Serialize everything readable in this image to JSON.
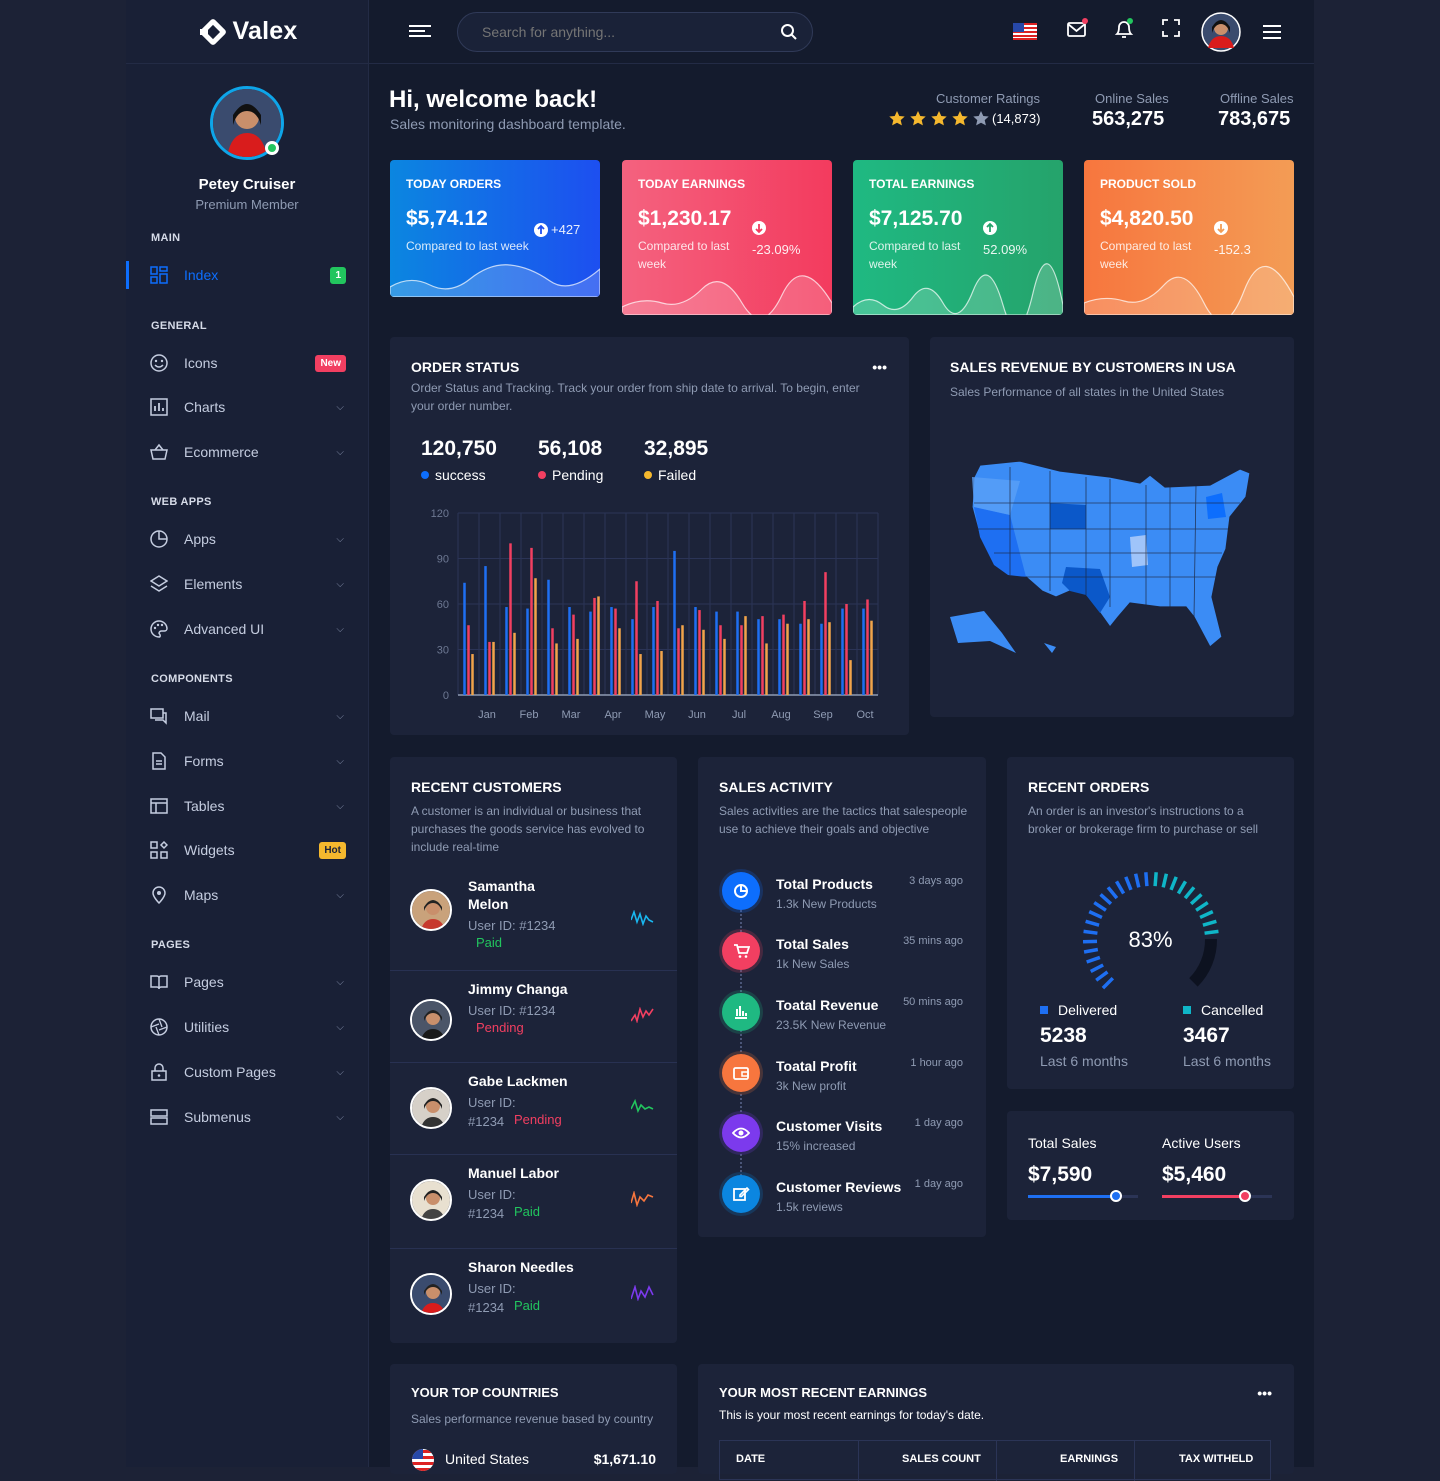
{
  "brand": {
    "name": "Valex"
  },
  "profile": {
    "name": "Petey Cruiser",
    "role": "Premium Member"
  },
  "sidebar": {
    "sections": {
      "main": "MAIN",
      "general": "GENERAL",
      "webapps": "WEB APPS",
      "components": "COMPONENTS",
      "pages": "PAGES"
    },
    "items": [
      {
        "label": "Index",
        "badge": "1",
        "icon": "dashboard-icon"
      },
      {
        "label": "Icons",
        "badge": "New",
        "icon": "smile-icon"
      },
      {
        "label": "Charts",
        "icon": "bar-chart-icon"
      },
      {
        "label": "Ecommerce",
        "icon": "basket-icon"
      },
      {
        "label": "Apps",
        "icon": "pie-icon"
      },
      {
        "label": "Elements",
        "icon": "layers-icon"
      },
      {
        "label": "Advanced UI",
        "icon": "palette-icon"
      },
      {
        "label": "Mail",
        "icon": "chat-icon"
      },
      {
        "label": "Forms",
        "icon": "document-icon"
      },
      {
        "label": "Tables",
        "icon": "table-icon"
      },
      {
        "label": "Widgets",
        "badge": "Hot",
        "icon": "widgets-icon"
      },
      {
        "label": "Maps",
        "icon": "map-pin-icon"
      },
      {
        "label": "Pages",
        "icon": "book-icon"
      },
      {
        "label": "Utilities",
        "icon": "aperture-icon"
      },
      {
        "label": "Custom Pages",
        "icon": "lock-icon"
      },
      {
        "label": "Submenus",
        "icon": "server-icon"
      }
    ]
  },
  "header": {
    "search_placeholder": "Search for anything..."
  },
  "welcome": {
    "title": "Hi, welcome back!",
    "subtitle": "Sales monitoring dashboard template.",
    "ratings_label": "Customer Ratings",
    "ratings_count": "(14,873)",
    "rating_value": 4,
    "online_label": "Online Sales",
    "online_value": "563,275",
    "offline_label": "Offline Sales",
    "offline_value": "783,675"
  },
  "stats": [
    {
      "title": "TODAY ORDERS",
      "value": "$5,74.12",
      "compare": "Compared to last week",
      "delta": "+427",
      "color1": "#0b86e0",
      "color2": "#1d4ff0"
    },
    {
      "title": "TODAY EARNINGS",
      "value": "$1,230.17",
      "compare": "Compared to last week",
      "delta": "-23.09%",
      "color1": "#f4627f",
      "color2": "#f33b5e"
    },
    {
      "title": "TOTAL EARNINGS",
      "value": "$7,125.70",
      "compare": "Compared to last week",
      "delta": "52.09%",
      "color1": "#1fb982",
      "color2": "#25a36b"
    },
    {
      "title": "PRODUCT SOLD",
      "value": "$4,820.50",
      "compare": "Compared to last week",
      "delta": "-152.3",
      "color1": "#f7763e",
      "color2": "#f39c55"
    }
  ],
  "order_status": {
    "title": "ORDER STATUS",
    "desc": "Order Status and Tracking. Track your order from ship date to arrival. To begin, enter your order number.",
    "kpis": [
      {
        "value": "120,750",
        "label": "success",
        "color": "#0d6efd"
      },
      {
        "value": "56,108",
        "label": "Pending",
        "color": "#f23f61"
      },
      {
        "value": "32,895",
        "label": "Failed",
        "color": "#f5b82e"
      }
    ]
  },
  "chart_data": {
    "type": "bar",
    "categories": [
      "Jan",
      "Feb",
      "Mar",
      "Apr",
      "May",
      "Jun",
      "Jul",
      "Aug",
      "Sep",
      "Oct"
    ],
    "ylim": [
      0,
      120
    ],
    "yticks": [
      0,
      30,
      60,
      90,
      120
    ],
    "series": [
      {
        "color": "#1e6ff2",
        "values": [
          [
            74
          ],
          [
            85
          ],
          [
            58
          ],
          [
            57
          ],
          [
            76
          ],
          [
            58
          ],
          [
            55
          ],
          [
            58
          ],
          [
            50
          ],
          [
            58
          ],
          [
            95
          ],
          [
            58
          ],
          [
            55
          ],
          [
            55
          ],
          [
            50
          ],
          [
            50
          ],
          [
            47
          ],
          [
            47
          ],
          [
            57
          ],
          [
            57
          ]
        ]
      },
      {
        "color": "#f23f61",
        "values": [
          [
            46
          ],
          [
            35
          ],
          [
            100
          ],
          [
            97
          ],
          [
            44
          ],
          [
            53
          ],
          [
            64
          ],
          [
            57
          ],
          [
            75
          ],
          [
            62
          ],
          [
            44
          ],
          [
            56
          ],
          [
            46
          ],
          [
            46
          ],
          [
            52
          ],
          [
            53
          ],
          [
            62
          ],
          [
            81
          ],
          [
            60
          ],
          [
            63
          ]
        ]
      },
      {
        "color": "#f2a44a",
        "values": [
          [
            27
          ],
          [
            35
          ],
          [
            41
          ],
          [
            77
          ],
          [
            34
          ],
          [
            37
          ],
          [
            65
          ],
          [
            44
          ],
          [
            27
          ],
          [
            29
          ],
          [
            46
          ],
          [
            43
          ],
          [
            37
          ],
          [
            52
          ],
          [
            34
          ],
          [
            47
          ],
          [
            50
          ],
          [
            48
          ],
          [
            23
          ],
          [
            49
          ]
        ]
      }
    ]
  },
  "map": {
    "title": "SALES REVENUE BY CUSTOMERS IN USA",
    "subtitle": "Sales Performance of all states in the United States"
  },
  "customers": {
    "title": "RECENT CUSTOMERS",
    "desc": "A customer is an individual or business that purchases the goods service has evolved to include real-time",
    "rows": [
      {
        "name": "Samantha Melon",
        "id": "User ID: #1234",
        "status": "Paid",
        "status_color": "#22c55e",
        "trend_color": "#19b7f0"
      },
      {
        "name": "Jimmy Changa",
        "id": "User ID: #1234",
        "status": "Pending",
        "status_color": "#f23f61",
        "trend_color": "#f23f61"
      },
      {
        "name": "Gabe Lackmen",
        "id": "User ID: #1234",
        "status": "Pending",
        "status_color": "#f23f61",
        "trend_color": "#22c55e"
      },
      {
        "name": "Manuel Labor",
        "id": "User ID: #1234",
        "status": "Paid",
        "status_color": "#22c55e",
        "trend_color": "#f7763e"
      },
      {
        "name": "Sharon Needles",
        "id": "User ID: #1234",
        "status": "Paid",
        "status_color": "#22c55e",
        "trend_color": "#7c3aed"
      }
    ]
  },
  "activity": {
    "title": "SALES ACTIVITY",
    "desc": "Sales activities are the tactics that salespeople use to achieve their goals and objective",
    "rows": [
      {
        "title": "Total Products",
        "sub": "1.3k New Products",
        "time": "3 days ago",
        "color": "#0d6efd",
        "icon": "pie-chart-icon"
      },
      {
        "title": "Total Sales",
        "sub": "1k New Sales",
        "time": "35 mins ago",
        "color": "#f23f61",
        "icon": "cart-icon"
      },
      {
        "title": "Toatal Revenue",
        "sub": "23.5K New Revenue",
        "time": "50 mins ago",
        "color": "#1fb982",
        "icon": "bar-chart-icon"
      },
      {
        "title": "Toatal Profit",
        "sub": "3k New profit",
        "time": "1 hour ago",
        "color": "#f7763e",
        "icon": "wallet-icon"
      },
      {
        "title": "Customer Visits",
        "sub": "15% increased",
        "time": "1 day ago",
        "color": "#7c3aed",
        "icon": "eye-icon"
      },
      {
        "title": "Customer Reviews",
        "sub": "1.5k reviews",
        "time": "1 day ago",
        "color": "#0b86e0",
        "icon": "edit-icon"
      }
    ]
  },
  "recent_orders": {
    "title": "RECENT ORDERS",
    "desc": "An order is an investor's instructions to a broker or brokerage firm to purchase or sell",
    "percent": "83%",
    "percent_value": 83,
    "delivered_label": "Delivered",
    "delivered_value": "5238",
    "delivered_period": "Last 6 months",
    "cancelled_label": "Cancelled",
    "cancelled_value": "3467",
    "cancelled_period": "Last 6 months"
  },
  "totals": {
    "sales_label": "Total Sales",
    "sales_value": "$7,590",
    "sales_level": 0.8,
    "users_label": "Active Users",
    "users_value": "$5,460",
    "users_level": 0.75
  },
  "countries": {
    "title": "YOUR TOP COUNTRIES",
    "desc": "Sales performance revenue based by country",
    "first_country": "United States",
    "first_value": "$1,671.10"
  },
  "earnings": {
    "title": "YOUR MOST RECENT EARNINGS",
    "desc": "This is your most recent earnings for today's date.",
    "headers": [
      "DATE",
      "SALES COUNT",
      "EARNINGS",
      "TAX WITHELD"
    ]
  }
}
